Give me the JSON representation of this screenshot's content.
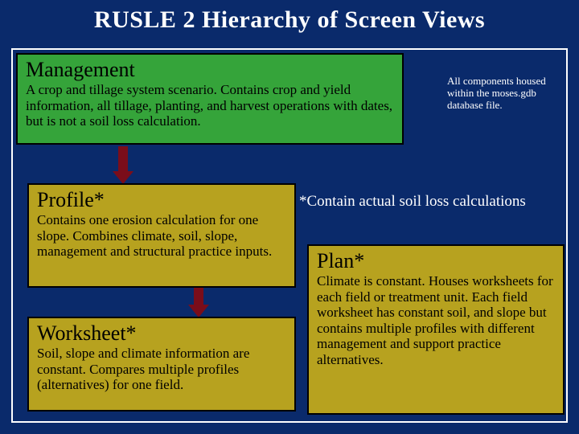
{
  "title": "RUSLE 2 Hierarchy of Screen Views",
  "management": {
    "heading": "Management",
    "body": "A crop and tillage system scenario. Contains crop and yield information, all tillage, planting, and harvest operations with dates, but is not a soil loss calculation."
  },
  "sidenote": "All components housed within the moses.gdb database file.",
  "profile": {
    "heading": "Profile*",
    "body": "Contains one erosion calculation for one slope. Combines climate, soil, slope, management and structural practice inputs."
  },
  "worksheet": {
    "heading": "Worksheet*",
    "body": "Soil, slope and climate information are constant. Compares multiple profiles (alternatives) for one field."
  },
  "plan": {
    "heading": "Plan*",
    "body": "Climate is constant. Houses worksheets for each field or treatment unit. Each field worksheet has constant soil, and slope but contains multiple profiles with different management and support practice alternatives."
  },
  "caption": "*Contain actual soil loss calculations"
}
